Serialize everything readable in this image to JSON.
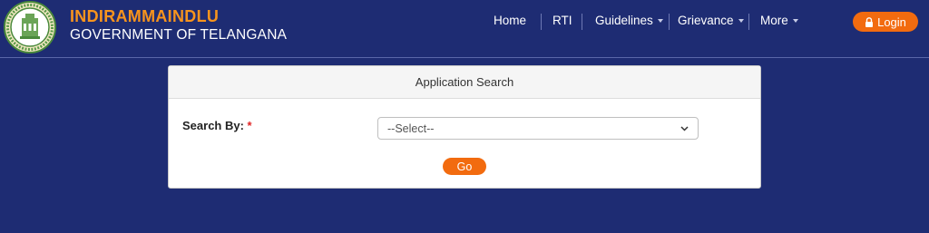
{
  "brand": {
    "title": "INDIRAMMAINDLU",
    "subtitle": "GOVERNMENT OF TELANGANA",
    "emblem_icon": "government-emblem-icon"
  },
  "nav": {
    "items": [
      {
        "label": "Home",
        "dropdown": false
      },
      {
        "label": "RTI",
        "dropdown": false
      },
      {
        "label": "Guidelines",
        "dropdown": true
      },
      {
        "label": "Grievance",
        "dropdown": true
      },
      {
        "label": "More",
        "dropdown": true
      }
    ],
    "login_label": "Login",
    "login_icon": "lock-icon"
  },
  "search_card": {
    "title": "Application Search",
    "search_by_label": "Search By:",
    "required_marker": "*",
    "select_value": "--Select--",
    "go_label": "Go"
  },
  "colors": {
    "background": "#1e2c73",
    "accent": "#f26b0f",
    "brand_title": "#f7941d"
  }
}
